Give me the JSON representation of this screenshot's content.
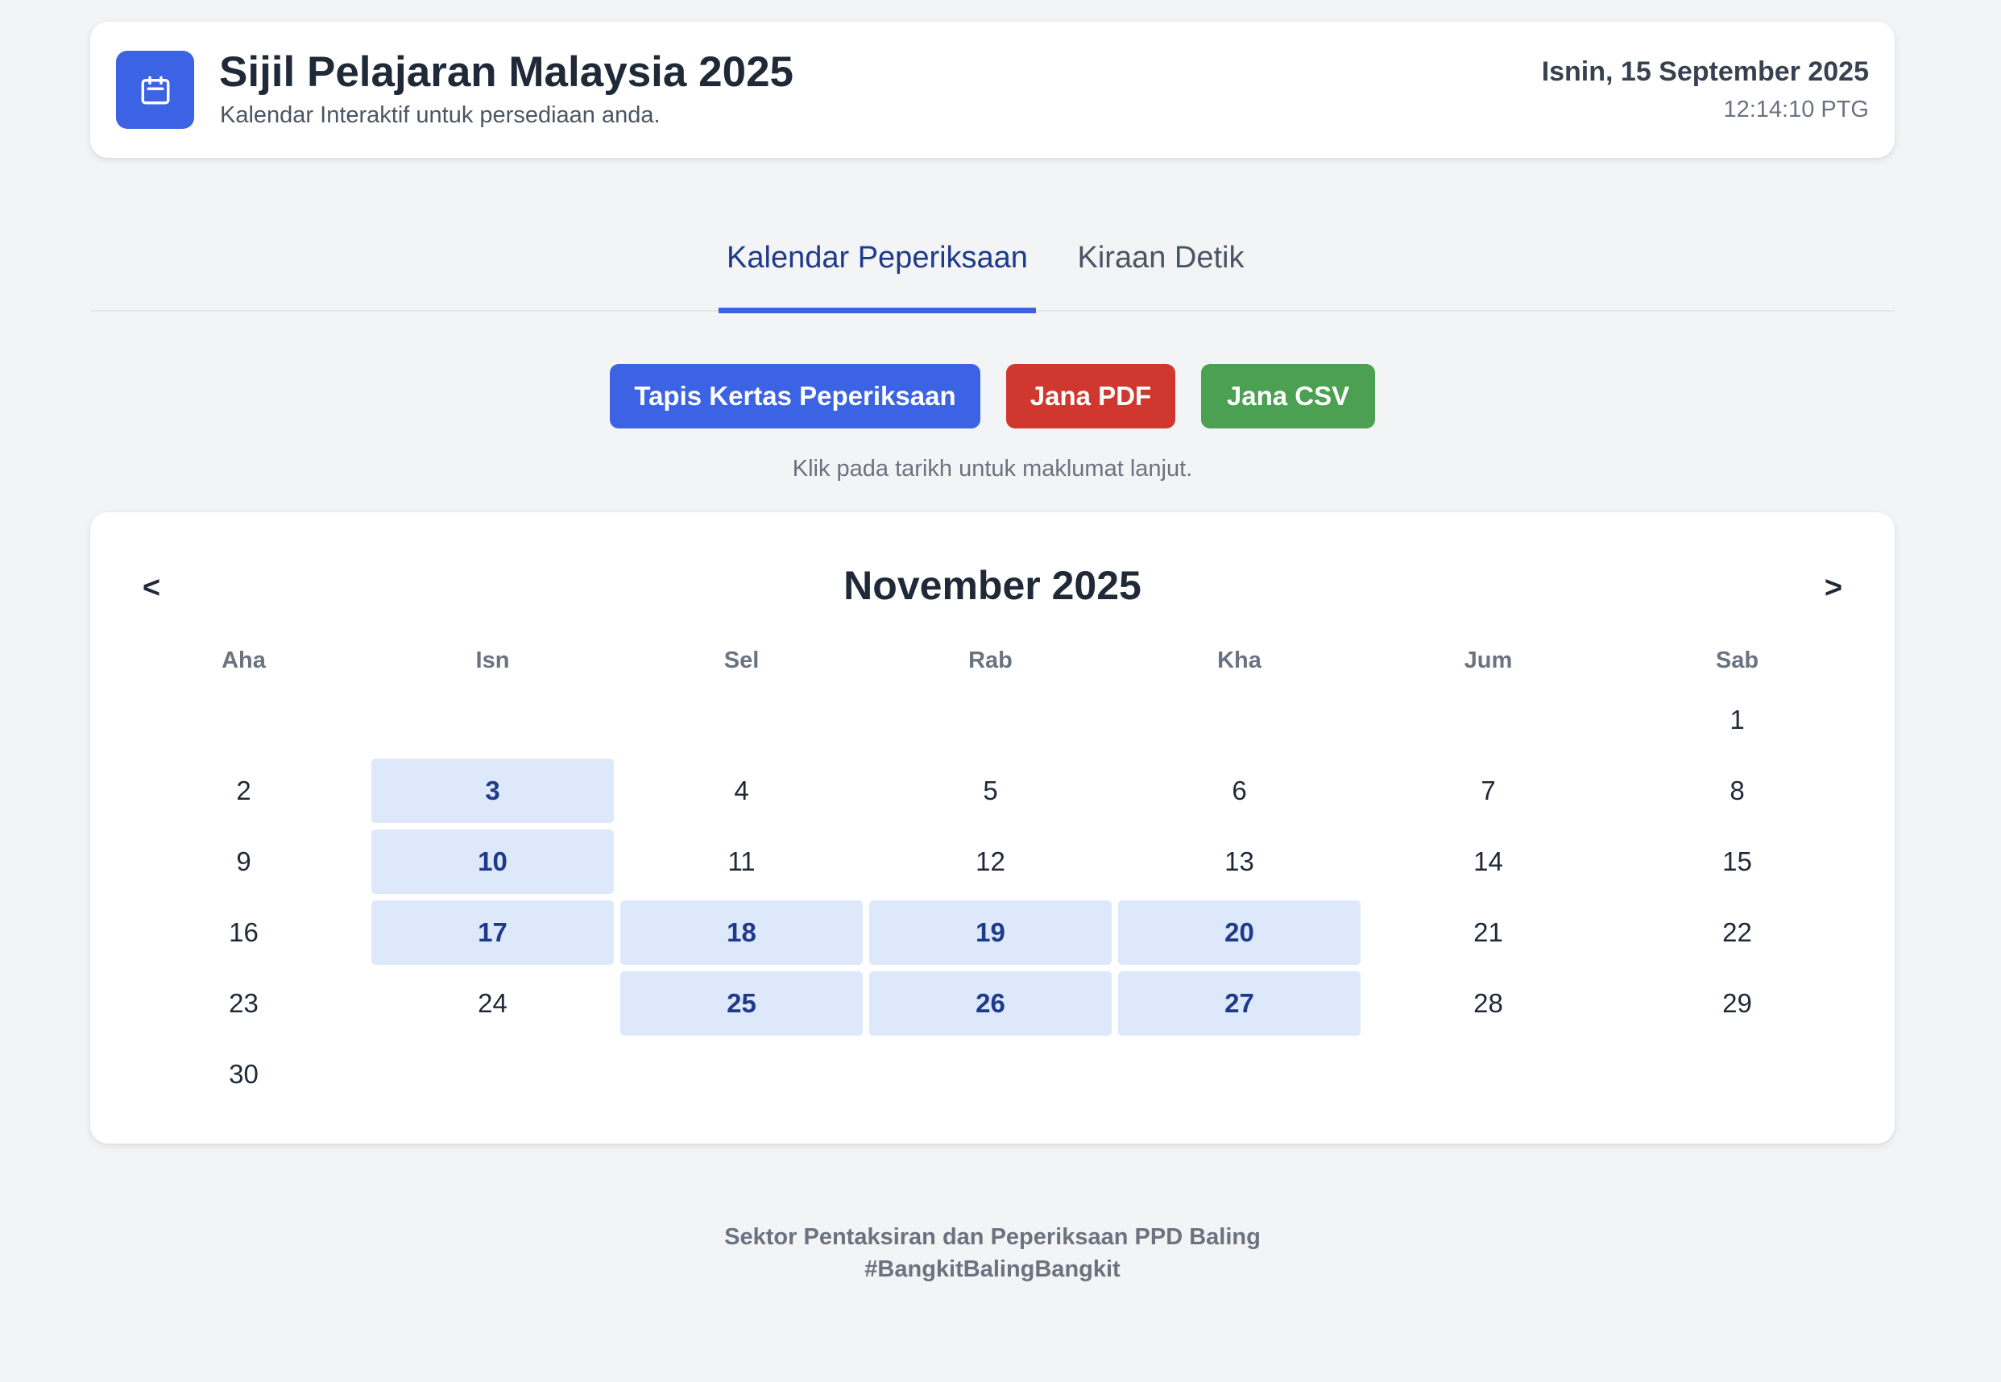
{
  "header": {
    "title": "Sijil Pelajaran Malaysia 2025",
    "subtitle": "Kalendar Interaktif untuk persediaan anda.",
    "date": "Isnin, 15 September 2025",
    "time": "12:14:10 PTG",
    "icon": "calendar-icon"
  },
  "tabs": [
    {
      "label": "Kalendar Peperiksaan",
      "active": true
    },
    {
      "label": "Kiraan Detik",
      "active": false
    }
  ],
  "actions": {
    "filter_label": "Tapis Kertas Peperiksaan",
    "pdf_label": "Jana PDF",
    "csv_label": "Jana CSV"
  },
  "hint": "Klik pada tarikh untuk maklumat lanjut.",
  "calendar": {
    "prev_label": "<",
    "next_label": ">",
    "month_title": "November 2025",
    "weekdays": [
      "Aha",
      "Isn",
      "Sel",
      "Rab",
      "Kha",
      "Jum",
      "Sab"
    ],
    "leading_blank_days": 6,
    "days_in_month": 30,
    "exam_days": [
      3,
      10,
      17,
      18,
      19,
      20,
      25,
      26,
      27
    ]
  },
  "footer": {
    "line1": "Sektor Pentaksiran dan Peperiksaan PPD Baling",
    "line2": "#BangkitBalingBangkit"
  },
  "colors": {
    "primary": "#3b63e3",
    "danger": "#d0382f",
    "success": "#4ba052",
    "exam_day_bg": "#dde8fa",
    "exam_day_text": "#1e3a8a",
    "page_bg": "#f3f4f6"
  }
}
